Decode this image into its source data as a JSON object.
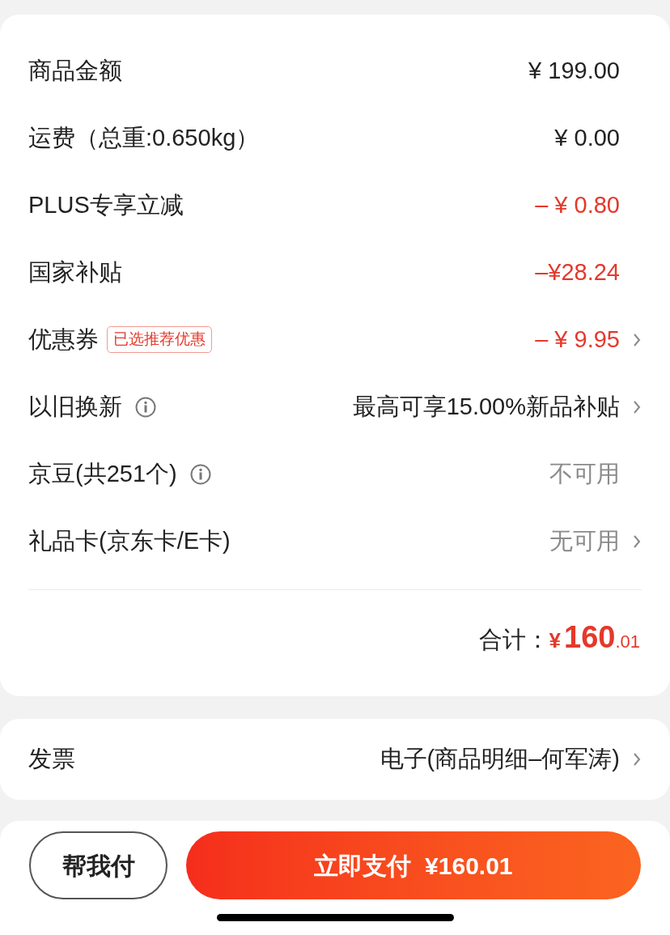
{
  "fees": [
    {
      "label": "商品金额",
      "value": "¥ 199.00",
      "kind": "normal"
    },
    {
      "label": "运费（总重:0.650kg）",
      "value": "¥ 0.00",
      "kind": "normal"
    },
    {
      "label": "PLUS专享立减",
      "value": "– ¥ 0.80",
      "kind": "discount"
    },
    {
      "label": "国家补贴",
      "value": "–¥28.24",
      "kind": "discount"
    },
    {
      "label": "优惠券",
      "tag": "已选推荐优惠",
      "value": "– ¥ 9.95",
      "kind": "discount",
      "chevron": true
    },
    {
      "label": "以旧换新",
      "info": true,
      "value": "最高可享15.00%新品补贴",
      "kind": "normal",
      "chevron": true
    },
    {
      "label": "京豆(共251个)",
      "info": true,
      "value": "不可用",
      "kind": "muted"
    },
    {
      "label": "礼品卡(京东卡/E卡)",
      "value": "无可用",
      "kind": "muted",
      "chevron": true
    }
  ],
  "total": {
    "label": "合计：",
    "symbol": "¥",
    "integer": "160",
    "decimal": ".01"
  },
  "invoice": {
    "label": "发票",
    "value": "电子(商品明细–何军涛)",
    "chevron": true
  },
  "buttons": {
    "secondary": "帮我付",
    "primary": "立即支付  ¥160.01"
  }
}
